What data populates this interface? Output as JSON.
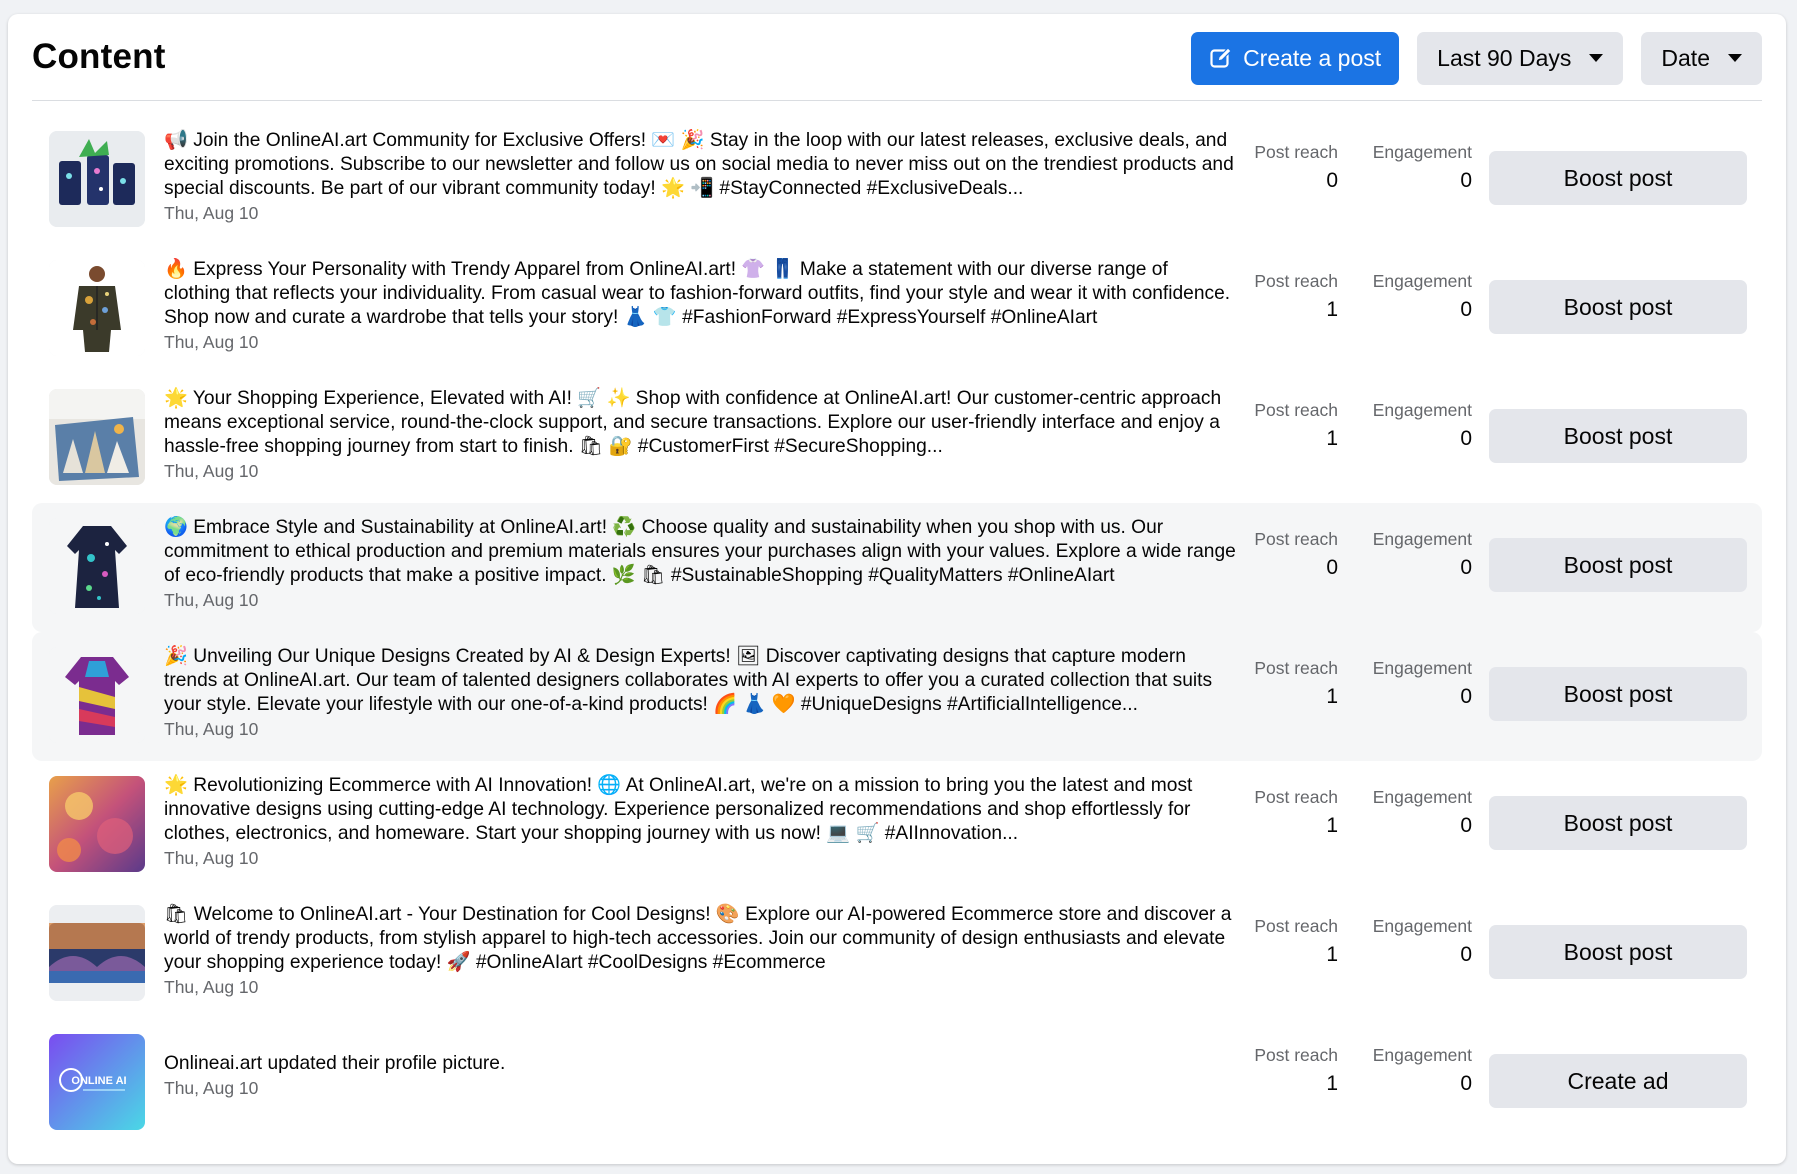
{
  "header": {
    "title": "Content",
    "create_post_label": "Create a post",
    "range_label": "Last 90 Days",
    "sort_label": "Date"
  },
  "colors": {
    "primary": "#1b74e4",
    "secondary_button": "#e4e6eb",
    "muted_text": "#65676b"
  },
  "posts": [
    {
      "text": "📢 Join the OnlineAI.art Community for Exclusive Offers! 💌 🎉 Stay in the loop with our latest releases, exclusive deals, and exciting promotions. Subscribe to our newsletter and follow us on social media to never miss out on the trendiest products and special discounts. Be part of our vibrant community today! 🌟 📲 #StayConnected #ExclusiveDeals...",
      "date": "Thu, Aug 10",
      "reach_label": "Post reach",
      "reach": "0",
      "engagement_label": "Engagement",
      "engagement": "0",
      "action": "Boost post",
      "thumb": "cups-icon"
    },
    {
      "text": "🔥 Express Your Personality with Trendy Apparel from OnlineAI.art! 👚 👖 Make a statement with our diverse range of clothing that reflects your individuality. From casual wear to fashion-forward outfits, find your style and wear it with confidence. Shop now and curate a wardrobe that tells your story! 👗 👕 #FashionForward #ExpressYourself #OnlineAIart",
      "date": "Thu, Aug 10",
      "reach_label": "Post reach",
      "reach": "1",
      "engagement_label": "Engagement",
      "engagement": "0",
      "action": "Boost post",
      "thumb": "jacket-icon"
    },
    {
      "text": "🌟 Your Shopping Experience, Elevated with AI! 🛒 ✨ Shop with confidence at OnlineAI.art! Our customer-centric approach means exceptional service, round-the-clock support, and secure transactions. Explore our user-friendly interface and enjoy a hassle-free shopping journey from start to finish. 🛍 🔐 #CustomerFirst #SecureShopping...",
      "date": "Thu, Aug 10",
      "reach_label": "Post reach",
      "reach": "1",
      "engagement_label": "Engagement",
      "engagement": "0",
      "action": "Boost post",
      "thumb": "canvas-icon"
    },
    {
      "text": "🌍 Embrace Style and Sustainability at OnlineAI.art! ♻️ Choose quality and sustainability when you shop with us. Our commitment to ethical production and premium materials ensures your purchases align with your values. Explore a wide range of eco-friendly products that make a positive impact. 🌿 🛍 #SustainableShopping #QualityMatters #OnlineAIart",
      "date": "Thu, Aug 10",
      "reach_label": "Post reach",
      "reach": "0",
      "engagement_label": "Engagement",
      "engagement": "0",
      "action": "Boost post",
      "thumb": "dress-icon",
      "highlight": true
    },
    {
      "text": "🎉 Unveiling Our Unique Designs Created by AI & Design Experts! 🖼 Discover captivating designs that capture modern trends at OnlineAI.art. Our team of talented designers collaborates with AI experts to offer you a curated collection that suits your style. Elevate your lifestyle with our one-of-a-kind products! 🌈 👗 🧡 #UniqueDesigns #ArtificialIntelligence...",
      "date": "Thu, Aug 10",
      "reach_label": "Post reach",
      "reach": "1",
      "engagement_label": "Engagement",
      "engagement": "0",
      "action": "Boost post",
      "thumb": "shirt-icon",
      "highlight": true
    },
    {
      "text": "🌟 Revolutionizing Ecommerce with AI Innovation! 🌐 At OnlineAI.art, we're on a mission to bring you the latest and most innovative designs using cutting-edge AI technology. Experience personalized recommendations and shop effortlessly for clothes, electronics, and homeware. Start your shopping journey with us now! 💻 🛒 #AIInnovation...",
      "date": "Thu, Aug 10",
      "reach_label": "Post reach",
      "reach": "1",
      "engagement_label": "Engagement",
      "engagement": "0",
      "action": "Boost post",
      "thumb": "painting-icon"
    },
    {
      "text": "🛍 Welcome to OnlineAI.art - Your Destination for Cool Designs! 🎨 Explore our AI-powered Ecommerce store and discover a world of trendy products, from stylish apparel to high-tech accessories. Join our community of design enthusiasts and elevate your shopping experience today! 🚀 #OnlineAIart #CoolDesigns #Ecommerce",
      "date": "Thu, Aug 10",
      "reach_label": "Post reach",
      "reach": "1",
      "engagement_label": "Engagement",
      "engagement": "0",
      "action": "Boost post",
      "thumb": "bridge-icon"
    },
    {
      "text": "Onlineai.art updated their profile picture.",
      "date": "Thu, Aug 10",
      "reach_label": "Post reach",
      "reach": "1",
      "engagement_label": "Engagement",
      "engagement": "0",
      "action": "Create ad",
      "thumb": "logo-icon",
      "logo_text": "ONLINE AI"
    }
  ]
}
